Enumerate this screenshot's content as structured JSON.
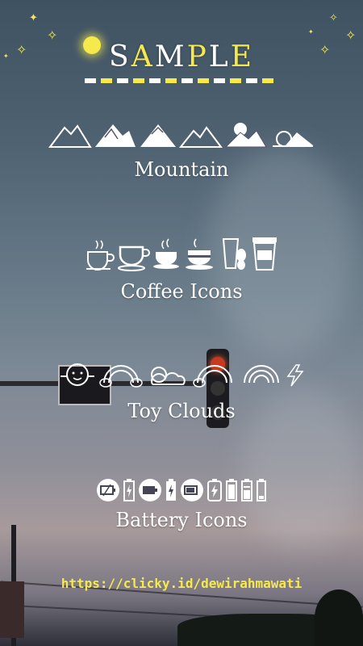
{
  "title": {
    "part1": "S",
    "part2": "A",
    "part3": "M",
    "part4": "P",
    "part5": "L",
    "part6": "E"
  },
  "sections": [
    {
      "label": "Mountain",
      "icons": [
        "mountain-icon",
        "mountain-icon",
        "mountain-icon",
        "mountain-icon",
        "mountain-sun-icon",
        "mountain-sunset-icon"
      ]
    },
    {
      "label": "Coffee Icons",
      "icons": [
        "coffee-cup-icon",
        "coffee-cup-icon",
        "coffee-cup-icon",
        "coffee-cup-icon",
        "coffee-beans-icon",
        "coffee-takeaway-icon"
      ]
    },
    {
      "label": "Toy Clouds",
      "icons": [
        "cloud-face-icon",
        "rainbow-cloud-icon",
        "cloud-sun-icon",
        "rainbow-cloud-icon",
        "rainbow-cloud-icon",
        "lightning-icon"
      ]
    },
    {
      "label": "Battery Icons",
      "icons": [
        "battery-circle-icon",
        "battery-charging-icon",
        "battery-circle-icon",
        "battery-bolt-icon",
        "battery-circle-icon",
        "battery-vertical-icon"
      ]
    }
  ],
  "url": "https://clicky.id/dewirahmawati",
  "colors": {
    "accent": "#f5e94c",
    "text": "#ffffff"
  }
}
